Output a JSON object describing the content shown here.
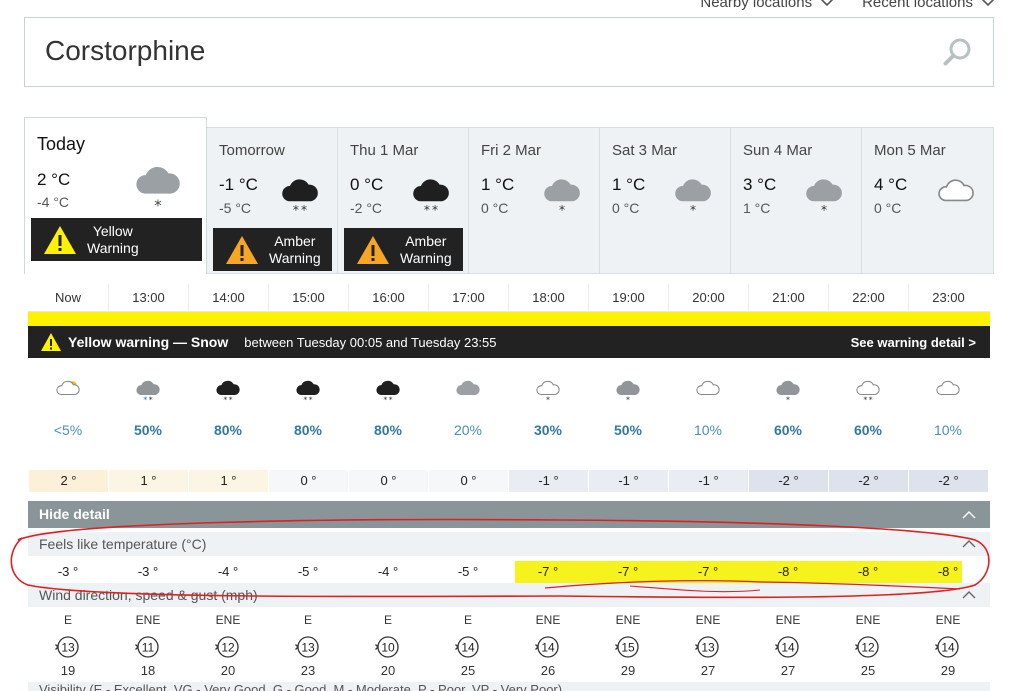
{
  "header": {
    "nearby_label": "Nearby locations",
    "recent_label": "Recent locations",
    "location": "Corstorphine"
  },
  "days": [
    {
      "name": "Today",
      "hi": "2 °C",
      "lo": "-4 °C",
      "icon": "heavy-snow-cloud-icon",
      "warning": {
        "level": "Yellow",
        "line1": "Yellow",
        "line2": "Warning",
        "color": "#fff200"
      }
    },
    {
      "name": "Tomorrow",
      "hi": "-1 °C",
      "lo": "-5 °C",
      "icon": "heavy-snow-black-cloud-icon",
      "warning": {
        "level": "Amber",
        "line1": "Amber",
        "line2": "Warning",
        "color": "#f6a623"
      }
    },
    {
      "name": "Thu 1 Mar",
      "hi": "0 °C",
      "lo": "-2 °C",
      "icon": "heavy-snow-black-cloud-icon",
      "warning": {
        "level": "Amber",
        "line1": "Amber",
        "line2": "Warning",
        "color": "#f6a623"
      }
    },
    {
      "name": "Fri 2 Mar",
      "hi": "1 °C",
      "lo": "0 °C",
      "icon": "light-snow-cloud-icon"
    },
    {
      "name": "Sat 3 Mar",
      "hi": "1 °C",
      "lo": "0 °C",
      "icon": "light-snow-cloud-icon"
    },
    {
      "name": "Sun 4 Mar",
      "hi": "3 °C",
      "lo": "1 °C",
      "icon": "light-snow-cloud-icon"
    },
    {
      "name": "Mon 5 Mar",
      "hi": "4 °C",
      "lo": "0 °C",
      "icon": "cloud-outline-icon"
    }
  ],
  "hours": [
    "Now",
    "13:00",
    "14:00",
    "15:00",
    "16:00",
    "17:00",
    "18:00",
    "19:00",
    "20:00",
    "21:00",
    "22:00",
    "23:00"
  ],
  "warning_bar": {
    "title": "Yellow warning — Snow",
    "range": "between Tuesday 00:05 and Tuesday 23:55",
    "detail": "See warning detail >"
  },
  "hourly": {
    "icons": [
      "sunny-intervals-icon",
      "sleet-shower-icon",
      "heavy-snow-shower-icon",
      "heavy-snow-shower-icon",
      "heavy-snow-shower-icon",
      "cloudy-icon",
      "snow-shower-night-icon",
      "light-snow-icon",
      "partly-cloudy-night-icon",
      "light-snow-icon",
      "heavy-snow-shower-night-icon",
      "cloud-outline-icon"
    ],
    "precip": [
      "<5%",
      "50%",
      "80%",
      "80%",
      "80%",
      "20%",
      "30%",
      "50%",
      "10%",
      "60%",
      "60%",
      "10%"
    ],
    "precip_bold": [
      false,
      true,
      true,
      true,
      true,
      false,
      true,
      true,
      false,
      true,
      true,
      false
    ],
    "temps": [
      "2 °",
      "1 °",
      "1 °",
      "0 °",
      "0 °",
      "0 °",
      "-1 °",
      "-1 °",
      "-1 °",
      "-2 °",
      "-2 °",
      "-2 °"
    ],
    "temp_colors": [
      "#fdf0d8",
      "#fdf5e4",
      "#fdf5e4",
      "#f6f7f9",
      "#f6f7f9",
      "#f6f7f9",
      "#e9edf3",
      "#e9edf3",
      "#e9edf3",
      "#dde2ec",
      "#dde2ec",
      "#dde2ec"
    ]
  },
  "detail": {
    "hide_label": "Hide detail",
    "feels_label": "Feels like temperature (°C)",
    "feels": [
      "-3 °",
      "-3 °",
      "-4 °",
      "-5 °",
      "-4 °",
      "-5 °",
      "-7 °",
      "-7 °",
      "-7 °",
      "-8 °",
      "-8 °",
      "-8 °"
    ],
    "wind_label": "Wind direction, speed & gust (mph)",
    "wind_dir": [
      "E",
      "ENE",
      "ENE",
      "E",
      "E",
      "E",
      "ENE",
      "ENE",
      "ENE",
      "ENE",
      "ENE",
      "ENE"
    ],
    "wind_speed": [
      "13",
      "11",
      "12",
      "13",
      "10",
      "14",
      "14",
      "15",
      "13",
      "14",
      "12",
      "14"
    ],
    "wind_gust": [
      "19",
      "18",
      "20",
      "23",
      "20",
      "25",
      "26",
      "29",
      "27",
      "27",
      "25",
      "29"
    ],
    "visibility_label": "Visibility (E - Excellent, VG - Very Good, G - Good, M - Moderate, P - Poor, VP - Very Poor)"
  },
  "colors": {
    "annotation_red": "#e02020",
    "highlight_yellow": "#f5f21c"
  }
}
